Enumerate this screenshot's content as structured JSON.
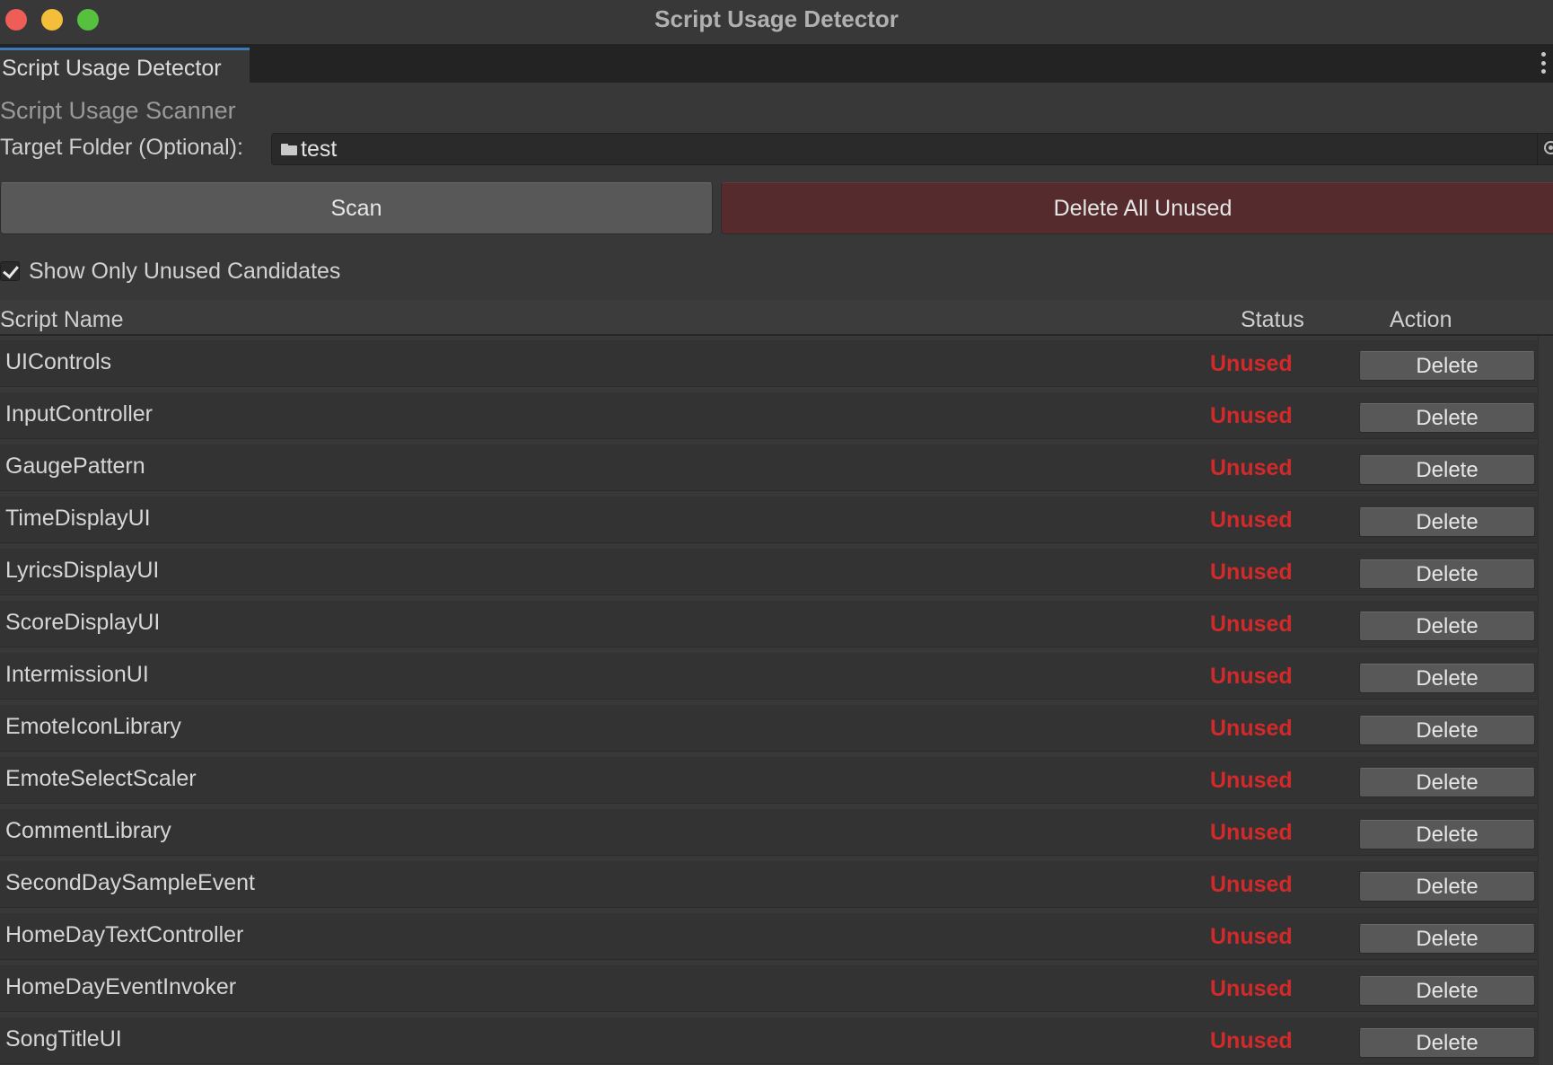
{
  "window": {
    "title": "Script Usage Detector"
  },
  "tab": {
    "label": "Script Usage Detector"
  },
  "scanner": {
    "section_label": "Script Usage Scanner",
    "target_folder_label": "Target Folder (Optional):",
    "target_folder_value": "test"
  },
  "buttons": {
    "scan": "Scan",
    "delete_all_unused": "Delete All Unused"
  },
  "filter": {
    "show_only_unused_label": "Show Only Unused Candidates",
    "checked": true
  },
  "table": {
    "headers": {
      "name": "Script Name",
      "status": "Status",
      "action": "Action"
    },
    "rows": [
      {
        "name": "UIControls",
        "status": "Unused",
        "action": "Delete"
      },
      {
        "name": "InputController",
        "status": "Unused",
        "action": "Delete"
      },
      {
        "name": "GaugePattern",
        "status": "Unused",
        "action": "Delete"
      },
      {
        "name": "TimeDisplayUI",
        "status": "Unused",
        "action": "Delete"
      },
      {
        "name": "LyricsDisplayUI",
        "status": "Unused",
        "action": "Delete"
      },
      {
        "name": "ScoreDisplayUI",
        "status": "Unused",
        "action": "Delete"
      },
      {
        "name": "IntermissionUI",
        "status": "Unused",
        "action": "Delete"
      },
      {
        "name": "EmoteIconLibrary",
        "status": "Unused",
        "action": "Delete"
      },
      {
        "name": "EmoteSelectScaler",
        "status": "Unused",
        "action": "Delete"
      },
      {
        "name": "CommentLibrary",
        "status": "Unused",
        "action": "Delete"
      },
      {
        "name": "SecondDaySampleEvent",
        "status": "Unused",
        "action": "Delete"
      },
      {
        "name": "HomeDayTextController",
        "status": "Unused",
        "action": "Delete"
      },
      {
        "name": "HomeDayEventInvoker",
        "status": "Unused",
        "action": "Delete"
      },
      {
        "name": "SongTitleUI",
        "status": "Unused",
        "action": "Delete"
      }
    ]
  },
  "colors": {
    "background": "#383838",
    "unused_status": "#d22a2a",
    "delete_all_button": "#552b2d",
    "tab_accent": "#3a79bb"
  },
  "icons": {
    "close": "close-icon",
    "minimize": "minimize-icon",
    "maximize": "maximize-icon",
    "folder": "folder-icon",
    "object_picker": "object-picker-icon",
    "more_menu": "more-menu-icon",
    "checkmark": "checkmark-icon"
  }
}
